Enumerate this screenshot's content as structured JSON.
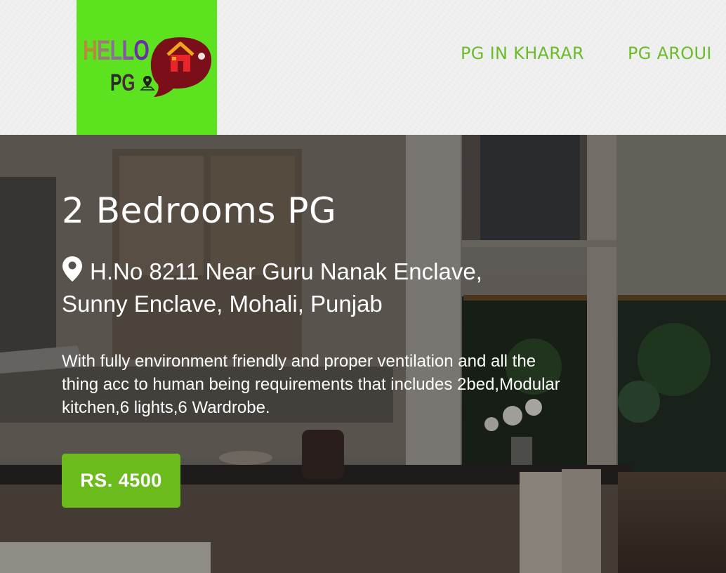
{
  "header": {
    "logo": {
      "word1": {
        "h": "H",
        "e": "E",
        "l1": "L",
        "l2": "L",
        "o": "O"
      },
      "word2": {
        "p": "P",
        "g": "G"
      },
      "colors": {
        "background": "#5ce21e",
        "bubble": "#7a0f1a",
        "house": "#e8262a",
        "roof": "#f2a31c"
      }
    },
    "nav": [
      {
        "label": "PG IN KHARAR"
      },
      {
        "label": "PG AROUI"
      }
    ],
    "nav_color": "#6cbb2a"
  },
  "hero": {
    "title": "2 Bedrooms PG",
    "address_icon": "location-pin-icon",
    "address": "H.No 8211 Near Guru Nanak Enclave, Sunny Enclave, Mohali, Punjab",
    "description": "With fully environment friendly and proper ventilation and all the thing acc to human being requirements that includes 2bed,Modular kitchen,6 lights,6 Wardrobe.",
    "price_label": "RS. 4500",
    "price_button_color": "#6cbb1d"
  }
}
